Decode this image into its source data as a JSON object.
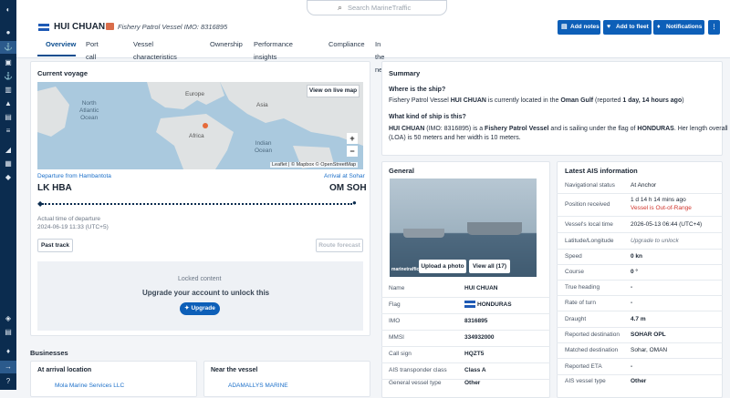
{
  "search": {
    "placeholder": "Search MarineTraffic"
  },
  "header": {
    "vessel_name": "HUI CHUAN",
    "subtitle": "Fishery Patrol Vessel  IMO: 8316895",
    "buttons": {
      "add_notes": "Add notes",
      "add_to_fleet": "Add to fleet",
      "notifications": "Notifications"
    }
  },
  "tabs": [
    "Overview",
    "Port call log",
    "Vessel characteristics",
    "Ownership",
    "Performance insights",
    "Compliance",
    "In the news"
  ],
  "current_voyage": {
    "title": "Current voyage",
    "view_live_map": "View on live map",
    "map_labels": {
      "north_atlantic": "North\nAtlantic\nOcean",
      "europe": "Europe",
      "africa": "Africa",
      "asia": "Asia",
      "indian_ocean": "Indian\nOcean"
    },
    "zoom_in": "+",
    "zoom_out": "−",
    "attribution": "Leaflet | © Mapbox © OpenStreetMap",
    "departure_label": "Departure from Hambantota",
    "arrival_label": "Arrival at Sohar",
    "departure_code": "LK HBA",
    "arrival_code": "OM SOH",
    "atd_label": "Actual time of departure",
    "atd_value": "2024-06-19 11:33 (UTC+5)",
    "past_track": "Past track",
    "route_forecast": "Route forecast",
    "locked_title": "Locked content",
    "locked_text": "Upgrade your account to unlock this",
    "upgrade": "Upgrade"
  },
  "businesses": {
    "title": "Businesses",
    "arrival_title": "At arrival location",
    "arrival_item": "Mola Marine Services LLC",
    "near_title": "Near the vessel",
    "near_item": "ADAMALLYS MARINE"
  },
  "summary": {
    "title": "Summary",
    "q1": "Where is the ship?",
    "a1_pre": "Fishery Patrol Vessel ",
    "a1_name": "HUI CHUAN",
    "a1_mid": " is currently located in the ",
    "a1_loc": "Oman Gulf",
    "a1_rep": " (reported ",
    "a1_time": "1 day, 14 hours ago",
    "a1_end": ")",
    "q2": "What kind of ship is this?",
    "a2_line1_name": "HUI CHUAN",
    "a2_line1_imo": " (IMO: 8316895) is a ",
    "a2_line1_type": "Fishery Patrol Vessel",
    "a2_line1_mid": " and is sailing under the flag of ",
    "a2_line1_flag": "HONDURAS",
    "a2_line1_end": ". Her length overall",
    "a2_line2": "(LOA) is 50 meters and her width is 10 meters."
  },
  "general": {
    "title": "General",
    "upload_photo": "Upload a photo",
    "view_all": "View all (17)",
    "watermark": "marinetraffic",
    "rows": [
      {
        "label": "Name",
        "value": "HUI CHUAN"
      },
      {
        "label": "Flag",
        "value": "HONDURAS"
      },
      {
        "label": "IMO",
        "value": "8316895"
      },
      {
        "label": "MMSI",
        "value": "334932000"
      },
      {
        "label": "Call sign",
        "value": "HQZT5"
      },
      {
        "label": "AIS transponder class",
        "value": "Class A"
      },
      {
        "label": "General vessel type",
        "value": "Other"
      }
    ]
  },
  "ais": {
    "title": "Latest AIS information",
    "rows": [
      {
        "label": "Navigational status",
        "value": "At Anchor"
      },
      {
        "label": "Position received",
        "value": "1 d 14 h 14 mins ago",
        "value2": "Vessel is Out-of-Range"
      },
      {
        "label": "Vessel's local time",
        "value": "2026-05-13 06:44 (UTC+4)"
      },
      {
        "label": "Latitude/Longitude",
        "value": "Upgrade to unlock"
      },
      {
        "label": "Speed",
        "value": "0 kn"
      },
      {
        "label": "Course",
        "value": "0 °"
      },
      {
        "label": "True heading",
        "value": "-"
      },
      {
        "label": "Rate of turn",
        "value": "-"
      },
      {
        "label": "Draught",
        "value": "4.7 m"
      },
      {
        "label": "Reported destination",
        "value": "SOHAR OPL"
      },
      {
        "label": "Matched destination",
        "value": "Sohar, OMAN"
      },
      {
        "label": "Reported ETA",
        "value": "-"
      },
      {
        "label": "AIS vessel type",
        "value": "Other"
      }
    ]
  },
  "colors": {
    "primary": "#0d5fb8",
    "sidebar": "#0b2c4f",
    "out_of_range": "#d0342c"
  }
}
